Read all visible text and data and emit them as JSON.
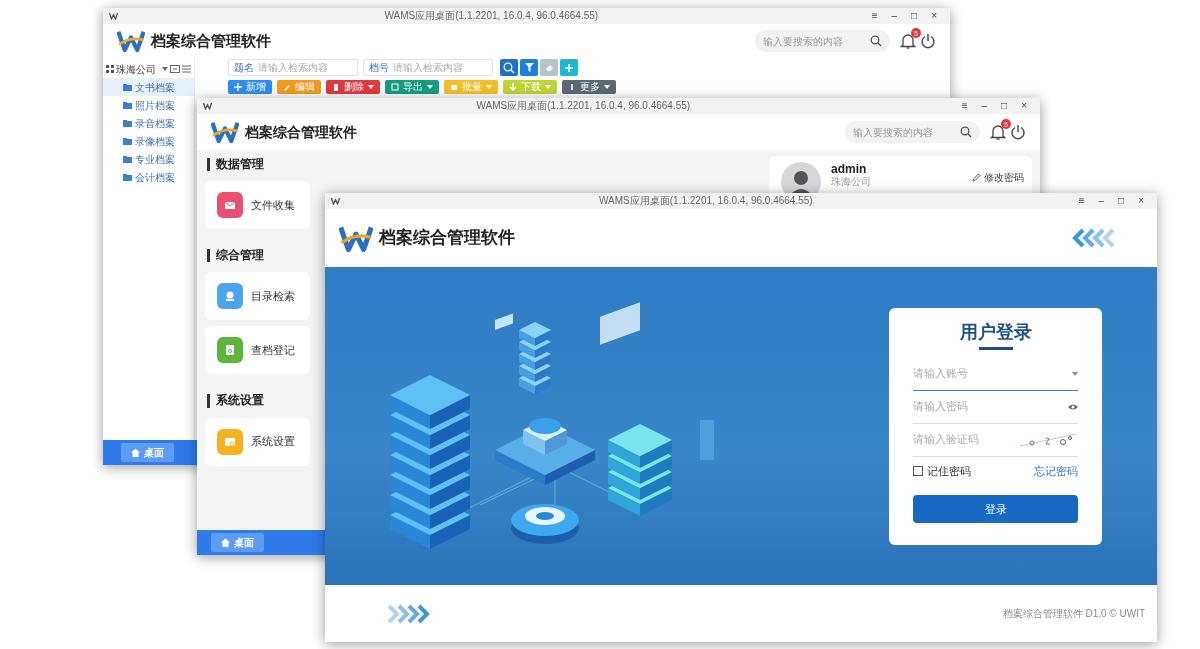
{
  "windows": [
    {
      "kind": "records",
      "title": "WAMS应用桌面(1.1.2201, 16.0.4, 96.0.4664.55)",
      "controls": [
        "≡",
        "–",
        "□",
        "×"
      ],
      "app_name": "档案综合管理软件",
      "search_placeholder": "输入要搜索的内容",
      "notifications": "5",
      "tree": {
        "root": "珠海公司",
        "items": [
          {
            "label": "文书档案",
            "selected": true
          },
          {
            "label": "照片档案",
            "selected": false
          },
          {
            "label": "录音档案",
            "selected": false
          },
          {
            "label": "录像档案",
            "selected": false
          },
          {
            "label": "专业档案",
            "selected": false
          },
          {
            "label": "会计档案",
            "selected": false
          }
        ]
      },
      "filters": [
        {
          "label": "题名",
          "placeholder": "请输入检索内容"
        },
        {
          "label": "档号",
          "placeholder": "请输入检索内容"
        }
      ],
      "tool_buttons": [
        {
          "kind": "search",
          "color": "#1f6fd1"
        },
        {
          "kind": "filter",
          "color": "#1f7fe0"
        },
        {
          "kind": "clear",
          "color": "#b8c2cc"
        },
        {
          "kind": "add",
          "color": "#1eb6d0"
        }
      ],
      "actions": [
        {
          "label": "新增",
          "color": "#2f8ef0",
          "dropdown": false
        },
        {
          "label": "编辑",
          "color": "#f39a1e",
          "dropdown": false
        },
        {
          "label": "删除",
          "color": "#e0393e",
          "dropdown": true
        },
        {
          "label": "导出",
          "color": "#149c80",
          "dropdown": true
        },
        {
          "label": "批量",
          "color": "#f5bf2a",
          "dropdown": true
        },
        {
          "label": "下载",
          "color": "#c2d434",
          "dropdown": true
        },
        {
          "label": "更多",
          "color": "#5b6977",
          "dropdown": true
        }
      ],
      "taskbar": [
        {
          "label": "桌面",
          "selected": true
        }
      ]
    },
    {
      "kind": "dashboard",
      "title": "WAMS应用桌面(1.1.2201, 16.0.4, 96.0.4664.55)",
      "controls": [
        "≡",
        "–",
        "□",
        "×"
      ],
      "app_name": "档案综合管理软件",
      "search_placeholder": "输入要搜索的内容",
      "notifications": "5",
      "sections": [
        {
          "title": "数据管理",
          "tiles": [
            {
              "label": "文件收集",
              "color": "#e9506f"
            }
          ]
        },
        {
          "title": "综合管理",
          "tiles": [
            {
              "label": "目录检索",
              "color": "#4ba4ee"
            },
            {
              "label": "查档登记",
              "color": "#5bb63a"
            }
          ]
        },
        {
          "title": "系统设置",
          "tiles": [
            {
              "label": "系统设置",
              "color": "#f3b21f"
            }
          ]
        }
      ],
      "user": {
        "name": "admin",
        "company": "珠海公司",
        "links": [
          "修改密码"
        ]
      },
      "taskbar": [
        {
          "label": "桌面",
          "selected": true
        }
      ]
    },
    {
      "kind": "login",
      "title": "WAMS应用桌面(1.1.2201, 16.0.4, 96.0.4664.55)",
      "controls": [
        "≡",
        "–",
        "□",
        "×"
      ],
      "app_name": "档案综合管理软件",
      "login": {
        "heading": "用户登录",
        "fields": [
          {
            "kind": "account",
            "placeholder": "请输入账号"
          },
          {
            "kind": "password",
            "placeholder": "请输入密码"
          },
          {
            "kind": "captcha",
            "placeholder": "请输入验证码"
          }
        ],
        "remember": {
          "label": "记住密码",
          "checked": false
        },
        "forgot": "忘记密码",
        "submit": "登录"
      },
      "footer": "档案综合管理软件 D1.0 © UWIT"
    }
  ]
}
